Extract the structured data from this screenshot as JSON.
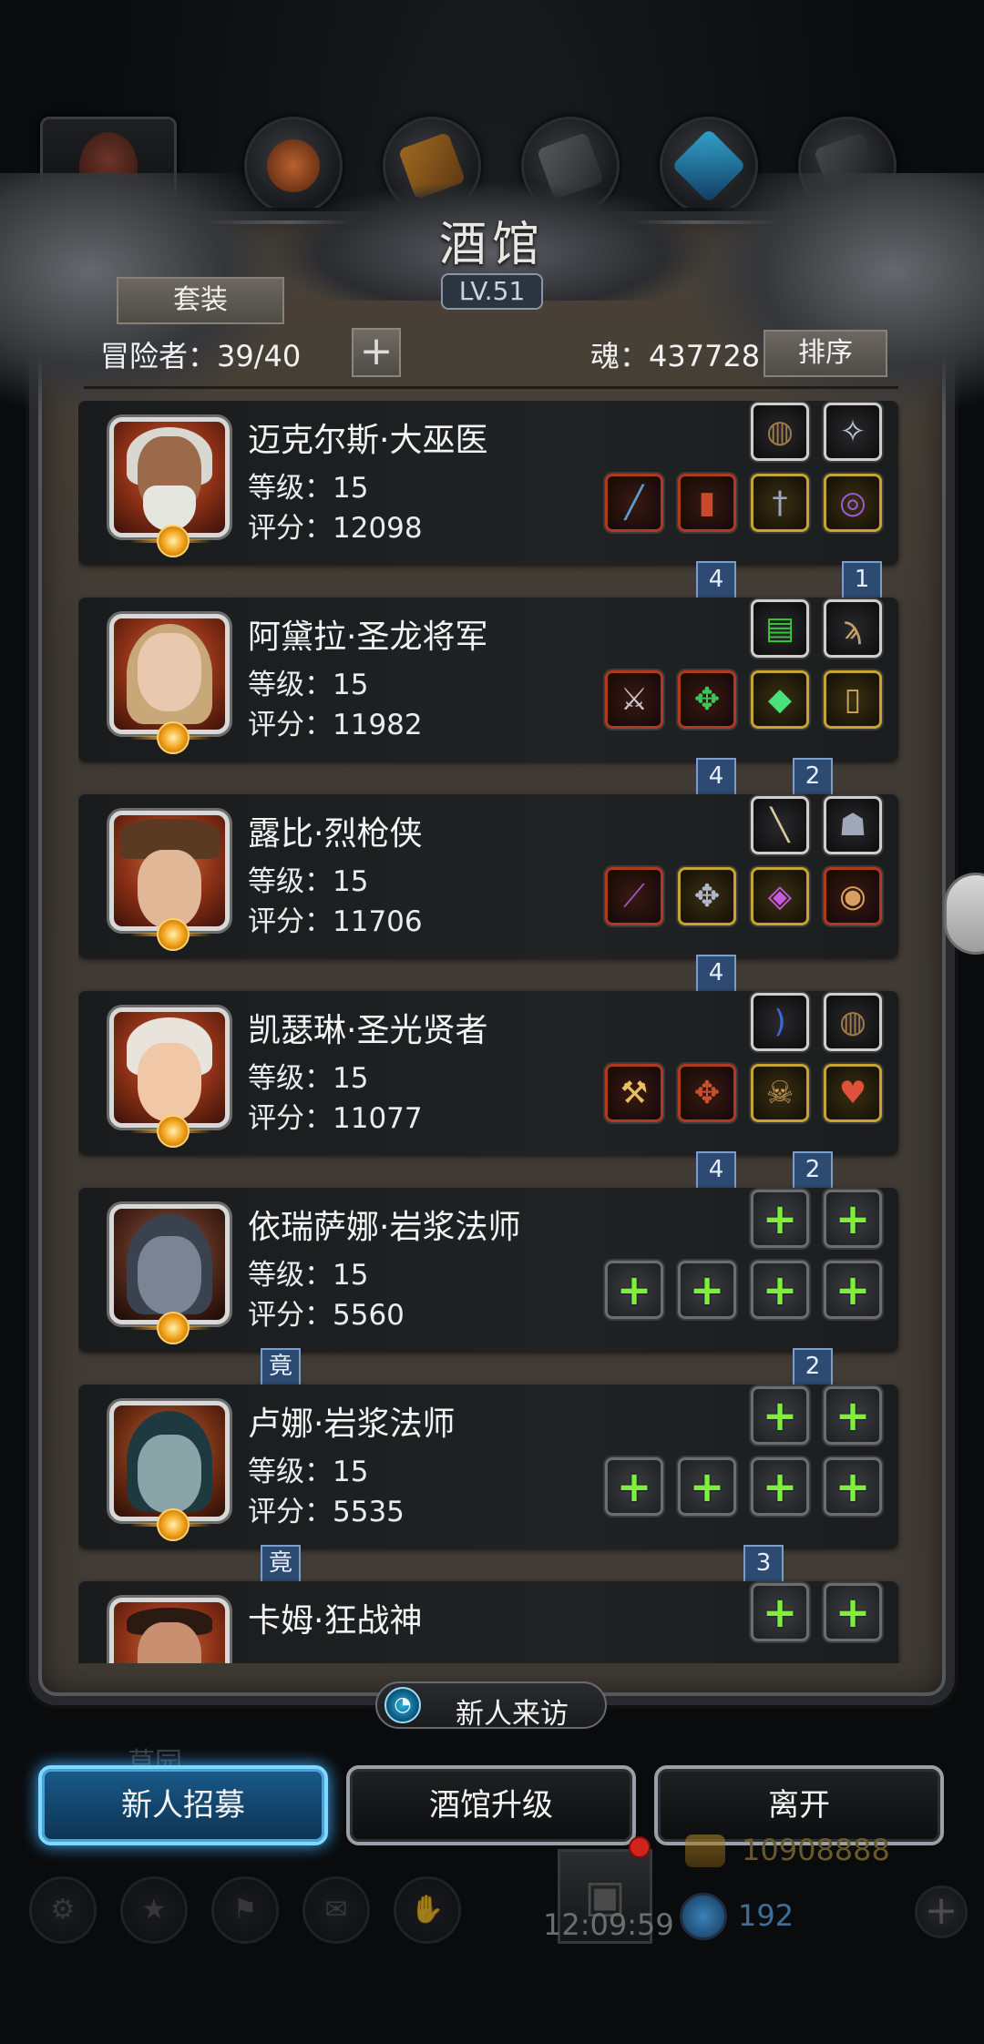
{
  "header": {
    "title": "酒馆",
    "level": "LV.51",
    "suit_label": "套装",
    "adventurer_label": "冒险者：39/40",
    "add_label": "+",
    "soul_label": "魂：437728",
    "sort_label": "排序"
  },
  "category_tabs": [
    {
      "name": "tab-hero",
      "icon": "hero-portrait"
    },
    {
      "name": "tab-ore",
      "icon": "ore-icon"
    },
    {
      "name": "tab-wood",
      "icon": "wood-icon"
    },
    {
      "name": "tab-stone",
      "icon": "stone-icon"
    },
    {
      "name": "tab-crystal",
      "icon": "crystal-icon"
    },
    {
      "name": "tab-iron",
      "icon": "iron-icon"
    }
  ],
  "heroes": [
    {
      "name": "迈克尔斯·大巫医",
      "level": "等级：15",
      "score": "评分：12098",
      "ribbons": [
        {
          "text": "4"
        },
        {
          "text": "1"
        }
      ]
    },
    {
      "name": "阿黛拉·圣龙将军",
      "level": "等级：15",
      "score": "评分：11982",
      "ribbons": [
        {
          "text": "4"
        },
        {
          "text": "2"
        }
      ]
    },
    {
      "name": "露比·烈枪侠",
      "level": "等级：15",
      "score": "评分：11706",
      "ribbons": [
        {
          "text": "4"
        }
      ]
    },
    {
      "name": "凯瑟琳·圣光贤者",
      "level": "等级：15",
      "score": "评分：11077",
      "ribbons": [
        {
          "text": "4"
        },
        {
          "text": "2"
        }
      ]
    },
    {
      "name": "依瑞萨娜·岩浆法师",
      "level": "等级：15",
      "score": "评分：5560",
      "ribbons": [
        {
          "text": "竟"
        },
        {
          "text": "2"
        }
      ]
    },
    {
      "name": "卢娜·岩浆法师",
      "level": "等级：15",
      "score": "评分：5535",
      "ribbons": [
        {
          "text": "竟"
        },
        {
          "text": "3"
        }
      ]
    },
    {
      "name": "卡姆·狂战神",
      "level": "",
      "score": "",
      "ribbons": []
    }
  ],
  "bottom": {
    "visit_label": "新人来访",
    "grass_label": "草园",
    "recruit_label": "新人招募",
    "upgrade_label": "酒馆升级",
    "leave_label": "离开",
    "clock": "12:09:59",
    "gold": "10908888",
    "gems": "192"
  },
  "colors": {
    "frame": "#403b35",
    "card": "#1e1f21",
    "ribbon": "#2d4a72",
    "primary_button": "#1a5a8a",
    "empty_slot_plus": "#7cf03c"
  }
}
